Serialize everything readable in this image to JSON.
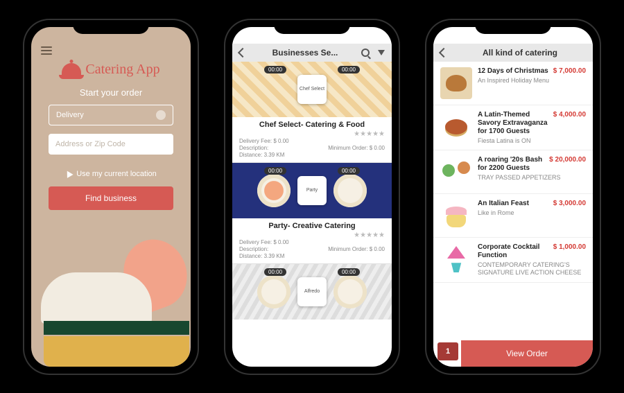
{
  "colors": {
    "accent": "#d65a54",
    "price": "#d43a34"
  },
  "screen1": {
    "logo_icon": "cloche-icon",
    "app_name": "Catering App",
    "title": "Start your order",
    "mode_selected": "Delivery",
    "address_placeholder": "Address or Zip Code",
    "use_location_label": "Use my current location",
    "find_button": "Find business"
  },
  "screen2": {
    "header_title": "Businesses Se...",
    "cards": [
      {
        "time_left": "00:00",
        "time_right": "00:00",
        "logo_text": "Chef Select",
        "title": "Chef Select- Catering & Food",
        "rating_stars": 5,
        "delivery_fee_label": "Delivery Fee: $ 0.00",
        "description_label": "Description:",
        "min_order_label": "Minimum Order: $ 0.00",
        "distance_label": "Distance: 3.39 KM"
      },
      {
        "time_left": "00:00",
        "time_right": "00:00",
        "logo_text": "Party",
        "title": "Party- Creative Catering",
        "rating_stars": 5,
        "delivery_fee_label": "Delivery Fee: $ 0.00",
        "description_label": "Description:",
        "min_order_label": "Minimum Order: $ 0.00",
        "distance_label": "Distance: 3.39 KM"
      },
      {
        "time_left": "00:00",
        "time_right": "00:00",
        "logo_text": "Alfredo"
      }
    ]
  },
  "screen3": {
    "header_title": "All kind of catering",
    "items": [
      {
        "name": "12 Days of Christmas",
        "price": "$ 7,000.00",
        "sub": "An Inspired Holiday Menu"
      },
      {
        "name": "A Latin-Themed Savory Extravaganza for 1700 Guests",
        "price": "$ 4,000.00",
        "sub": "Fiesta Latina is ON"
      },
      {
        "name": "A roaring '20s Bash for 2200 Guests",
        "price": "$ 20,000.00",
        "sub": "TRAY PASSED APPETIZERS"
      },
      {
        "name": "An Italian Feast",
        "price": "$ 3,000.00",
        "sub": "Like in Rome"
      },
      {
        "name": "Corporate Cocktail Function",
        "price": "$ 1,000.00",
        "sub": "CONTEMPORARY CATERING'S SIGNATURE LIVE ACTION CHEESE"
      }
    ],
    "order_count": "1",
    "view_order_label": "View Order"
  }
}
